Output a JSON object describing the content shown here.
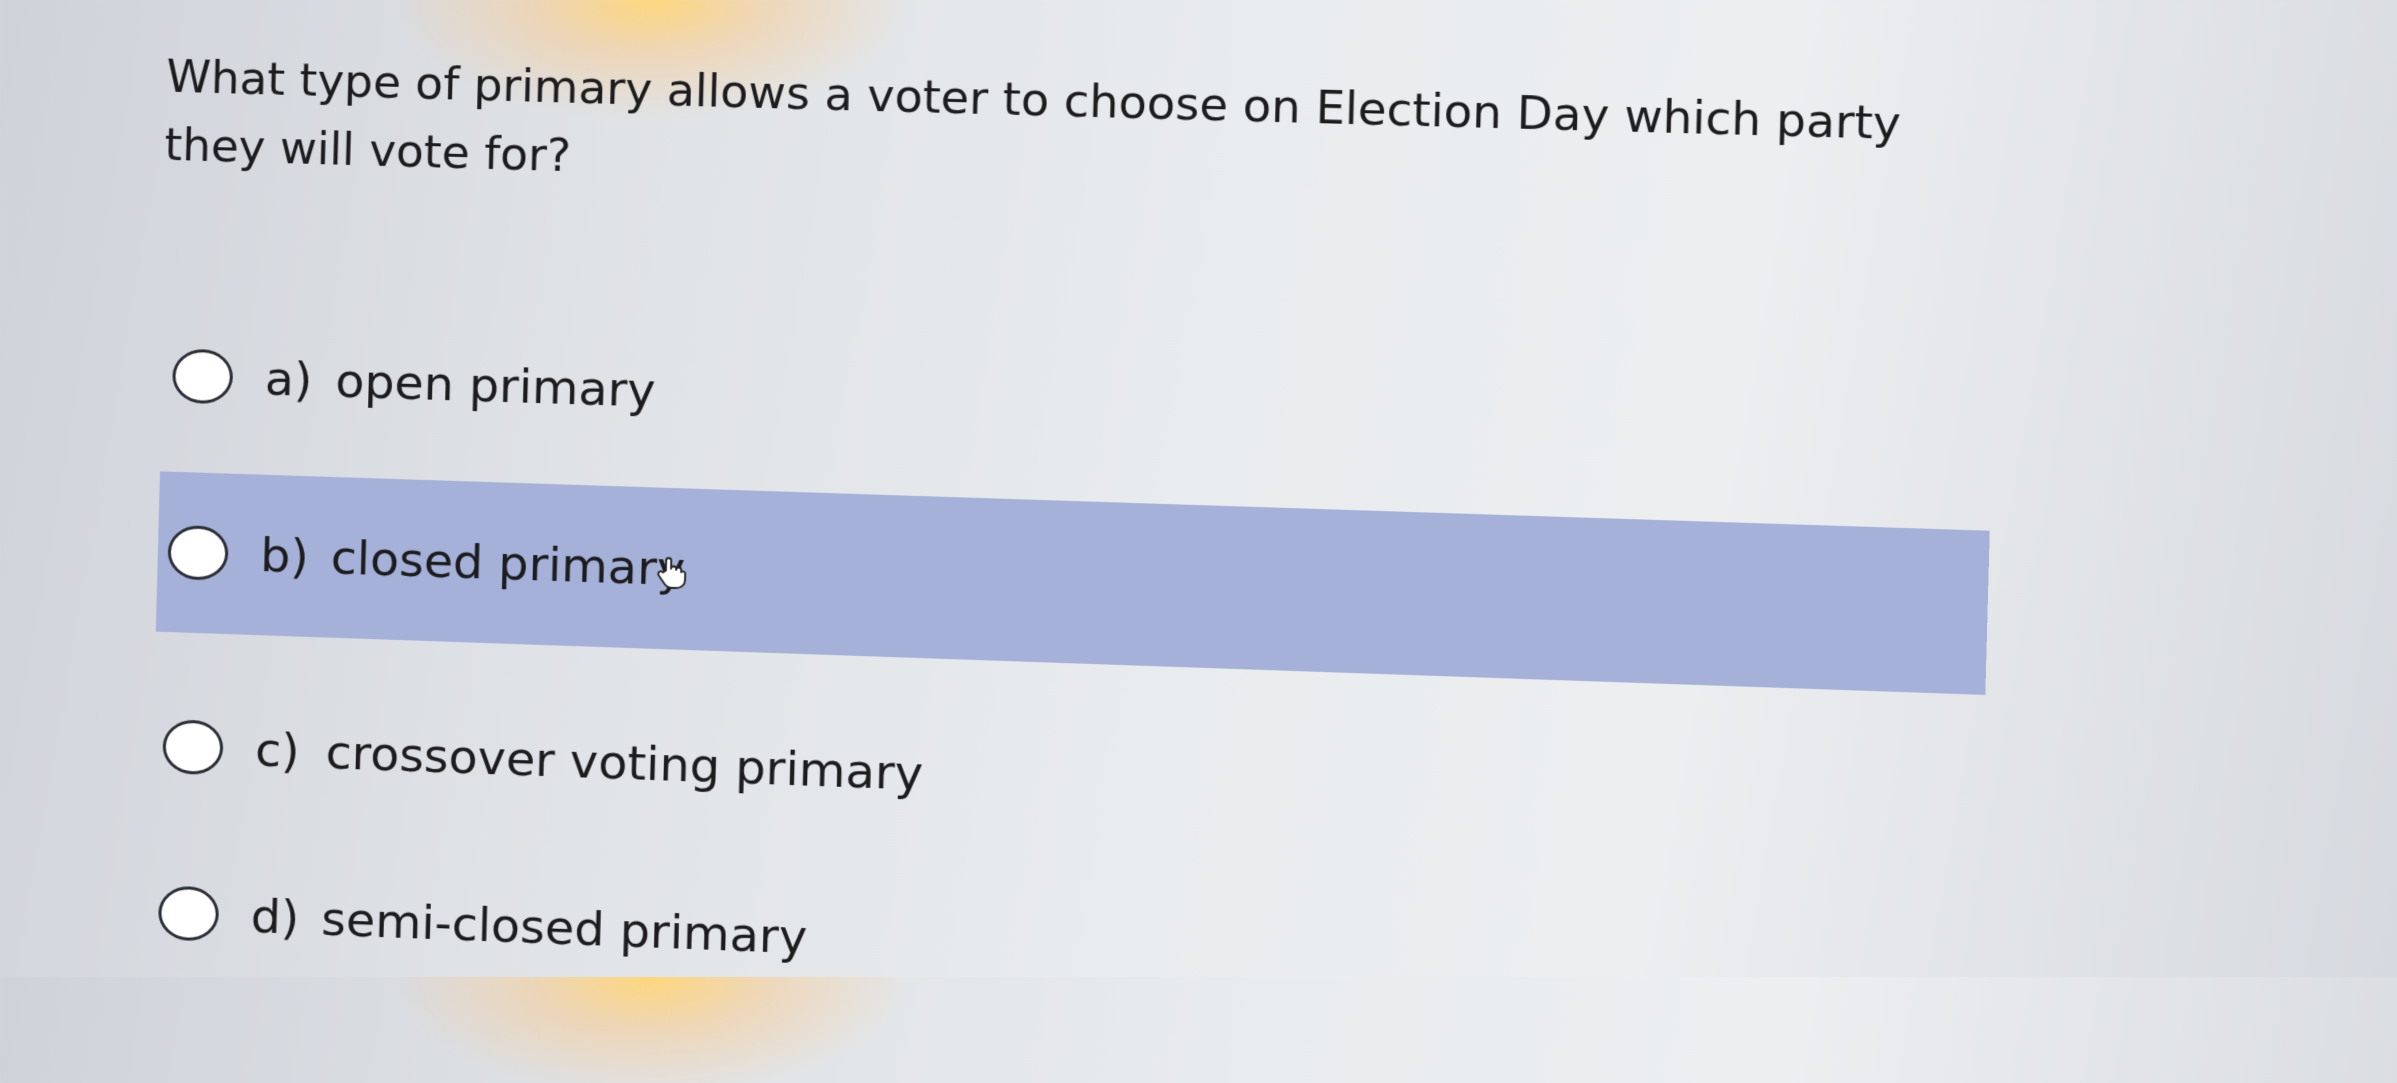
{
  "quiz": {
    "question": "What type of primary allows a voter to choose on Election Day which party they will vote for?",
    "options": [
      {
        "letter": "a)",
        "text": "open primary",
        "selected": false
      },
      {
        "letter": "b)",
        "text": "closed primary",
        "selected": true
      },
      {
        "letter": "c)",
        "text": "crossover voting primary",
        "selected": false
      },
      {
        "letter": "d)",
        "text": "semi-closed primary",
        "selected": false
      }
    ],
    "highlight_color": "#a6b1d9"
  },
  "cursor": {
    "icon": "hand-pointer-icon"
  }
}
